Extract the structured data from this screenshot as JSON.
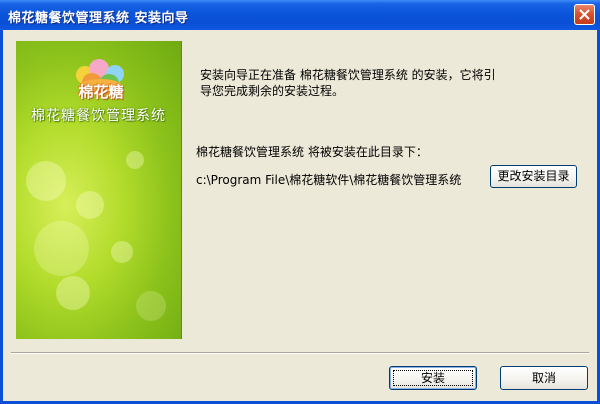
{
  "window": {
    "title": "棉花糖餐饮管理系统  安装向导"
  },
  "banner": {
    "logo_text": "棉花糖",
    "product_name": "棉花糖餐饮管理系统"
  },
  "content": {
    "intro_line1": "安装向导正在准备 棉花糖餐饮管理系统 的安装，它将引",
    "intro_line2": "导您完成剩余的安装过程。",
    "target_label": "棉花糖餐饮管理系统 将被安装在此目录下：",
    "install_path": "c:\\Program File\\棉花糖软件\\棉花糖餐饮管理系统",
    "change_dir_label": "更改安装目录"
  },
  "buttons": {
    "install_label": "安装",
    "cancel_label": "取消"
  },
  "colors": {
    "titlebar": "#0a4fd6",
    "dialog_bg": "#ece9d8",
    "banner_green": "#a6d62a",
    "close_red": "#d6502d"
  }
}
